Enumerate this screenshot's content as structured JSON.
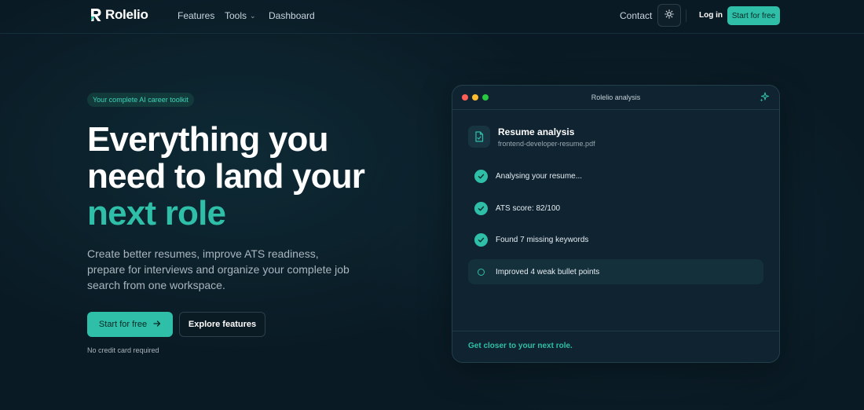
{
  "brand": {
    "name": "Rolelio",
    "accent_color": "#2fbfa8"
  },
  "nav": {
    "features": "Features",
    "tools": "Tools",
    "dashboard": "Dashboard",
    "contact": "Contact",
    "login": "Log in",
    "start": "Start for free"
  },
  "hero": {
    "badge": "Your complete AI career toolkit",
    "headline_line1": "Everything you",
    "headline_line2": "need to land your",
    "headline_accent": "next role",
    "subtext": "Create better resumes, improve ATS readiness, prepare for interviews and organize your complete job search from one workspace.",
    "cta_primary": "Start for free",
    "cta_secondary": "Explore features",
    "note": "No credit card required"
  },
  "card": {
    "window_title": "Rolelio analysis",
    "resume_title": "Resume analysis",
    "resume_file": "frontend-developer-resume.pdf",
    "steps": [
      {
        "label": "Analysing your resume...",
        "done": true
      },
      {
        "label": "ATS score: 82/100",
        "done": true
      },
      {
        "label": "Found 7 missing keywords",
        "done": true
      },
      {
        "label": "Improved 4 weak bullet points",
        "done": false
      }
    ],
    "footer": "Get closer to your next role."
  }
}
